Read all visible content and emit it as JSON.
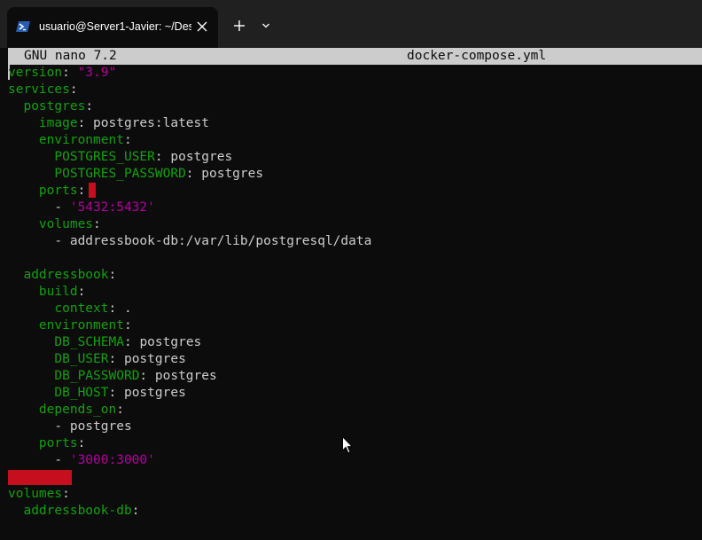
{
  "tab": {
    "icon": "powershell-icon",
    "title": "usuario@Server1-Javier: ~/Des",
    "close_icon": "close-icon"
  },
  "toolbar": {
    "new_tab_icon": "plus-icon",
    "dropdown_icon": "chevron-down-icon"
  },
  "nano": {
    "header_left": "GNU nano 7.2",
    "file_name": "docker-compose.yml"
  },
  "colors": {
    "key": "#13a10e",
    "string": "#b4009e",
    "text": "#cccccc",
    "highlight": "#c50f1f",
    "background": "#0c0c0c",
    "header_bg": "#cccccc"
  },
  "lines": [
    {
      "parts": [
        {
          "t": "k",
          "v": "version"
        },
        {
          "t": "p",
          "v": ": "
        },
        {
          "t": "s",
          "v": "\"3.9\""
        }
      ]
    },
    {
      "parts": [
        {
          "t": "k",
          "v": "services"
        },
        {
          "t": "p",
          "v": ":"
        }
      ]
    },
    {
      "parts": [
        {
          "t": "p",
          "v": "  "
        },
        {
          "t": "k",
          "v": "postgres"
        },
        {
          "t": "p",
          "v": ":"
        }
      ]
    },
    {
      "parts": [
        {
          "t": "p",
          "v": "    "
        },
        {
          "t": "k",
          "v": "image"
        },
        {
          "t": "p",
          "v": ": "
        },
        {
          "t": "v",
          "v": "postgres:latest"
        }
      ]
    },
    {
      "parts": [
        {
          "t": "p",
          "v": "    "
        },
        {
          "t": "k",
          "v": "environment"
        },
        {
          "t": "p",
          "v": ":"
        }
      ]
    },
    {
      "parts": [
        {
          "t": "p",
          "v": "      "
        },
        {
          "t": "k",
          "v": "POSTGRES_USER"
        },
        {
          "t": "p",
          "v": ": "
        },
        {
          "t": "v",
          "v": "postgres"
        }
      ]
    },
    {
      "parts": [
        {
          "t": "p",
          "v": "      "
        },
        {
          "t": "k",
          "v": "POSTGRES_PASSWORD"
        },
        {
          "t": "p",
          "v": ": "
        },
        {
          "t": "v",
          "v": "postgres"
        }
      ]
    },
    {
      "parts": [
        {
          "t": "p",
          "v": "    "
        },
        {
          "t": "k",
          "v": "ports"
        },
        {
          "t": "p",
          "v": ":"
        }
      ]
    },
    {
      "parts": [
        {
          "t": "p",
          "v": "      - "
        },
        {
          "t": "s",
          "v": "'5432:5432'"
        }
      ]
    },
    {
      "parts": [
        {
          "t": "p",
          "v": "    "
        },
        {
          "t": "k",
          "v": "volumes"
        },
        {
          "t": "p",
          "v": ":"
        }
      ]
    },
    {
      "parts": [
        {
          "t": "p",
          "v": "      - "
        },
        {
          "t": "v",
          "v": "addressbook-db:/var/lib/postgresql/data"
        }
      ]
    },
    {
      "parts": []
    },
    {
      "parts": [
        {
          "t": "p",
          "v": "  "
        },
        {
          "t": "k",
          "v": "addressbook"
        },
        {
          "t": "p",
          "v": ":"
        }
      ]
    },
    {
      "parts": [
        {
          "t": "p",
          "v": "    "
        },
        {
          "t": "k",
          "v": "build"
        },
        {
          "t": "p",
          "v": ":"
        }
      ]
    },
    {
      "parts": [
        {
          "t": "p",
          "v": "      "
        },
        {
          "t": "k",
          "v": "context"
        },
        {
          "t": "p",
          "v": ": "
        },
        {
          "t": "v",
          "v": "."
        }
      ]
    },
    {
      "parts": [
        {
          "t": "p",
          "v": "    "
        },
        {
          "t": "k",
          "v": "environment"
        },
        {
          "t": "p",
          "v": ":"
        }
      ]
    },
    {
      "parts": [
        {
          "t": "p",
          "v": "      "
        },
        {
          "t": "k",
          "v": "DB_SCHEMA"
        },
        {
          "t": "p",
          "v": ": "
        },
        {
          "t": "v",
          "v": "postgres"
        }
      ]
    },
    {
      "parts": [
        {
          "t": "p",
          "v": "      "
        },
        {
          "t": "k",
          "v": "DB_USER"
        },
        {
          "t": "p",
          "v": ": "
        },
        {
          "t": "v",
          "v": "postgres"
        }
      ]
    },
    {
      "parts": [
        {
          "t": "p",
          "v": "      "
        },
        {
          "t": "k",
          "v": "DB_PASSWORD"
        },
        {
          "t": "p",
          "v": ": "
        },
        {
          "t": "v",
          "v": "postgres"
        }
      ]
    },
    {
      "parts": [
        {
          "t": "p",
          "v": "      "
        },
        {
          "t": "k",
          "v": "DB_HOST"
        },
        {
          "t": "p",
          "v": ": "
        },
        {
          "t": "v",
          "v": "postgres"
        }
      ]
    },
    {
      "parts": [
        {
          "t": "p",
          "v": "    "
        },
        {
          "t": "k",
          "v": "depends_on"
        },
        {
          "t": "p",
          "v": ":"
        }
      ]
    },
    {
      "parts": [
        {
          "t": "p",
          "v": "      - "
        },
        {
          "t": "v",
          "v": "postgres"
        }
      ]
    },
    {
      "parts": [
        {
          "t": "p",
          "v": "    "
        },
        {
          "t": "k",
          "v": "ports"
        },
        {
          "t": "p",
          "v": ":"
        }
      ]
    },
    {
      "parts": [
        {
          "t": "p",
          "v": "      - "
        },
        {
          "t": "s",
          "v": "'3000:3000'"
        }
      ]
    },
    {
      "parts": []
    },
    {
      "parts": [
        {
          "t": "k",
          "v": "volumes"
        },
        {
          "t": "p",
          "v": ":"
        }
      ]
    },
    {
      "parts": [
        {
          "t": "p",
          "v": "  "
        },
        {
          "t": "k",
          "v": "addressbook-db"
        },
        {
          "t": "p",
          "v": ":"
        }
      ]
    }
  ],
  "pointer_icon": "mouse-pointer-icon"
}
